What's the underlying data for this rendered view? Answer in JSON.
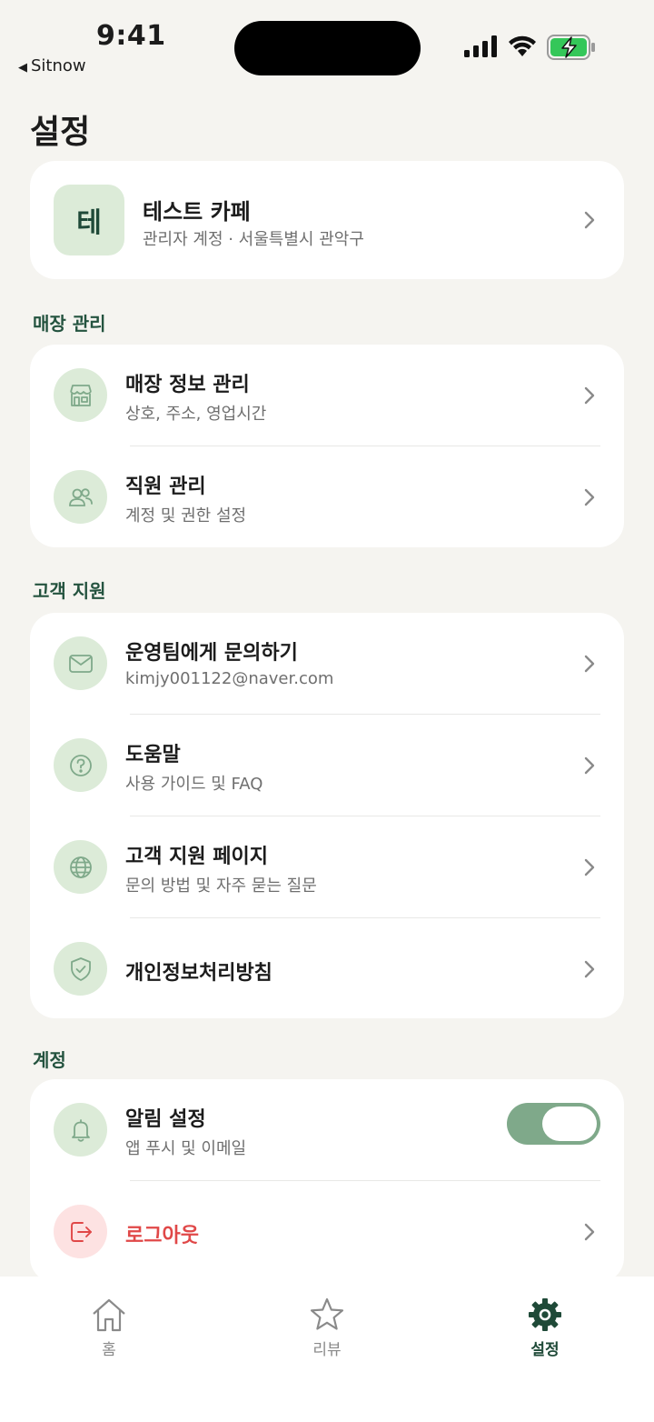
{
  "status_bar": {
    "time": "9:41",
    "back_app": "Sitnow"
  },
  "page": {
    "title": "설정"
  },
  "profile": {
    "avatar_letter": "테",
    "name": "테스트 카페",
    "subtitle": "관리자 계정 · 서울특별시 관악구"
  },
  "sections": {
    "store": {
      "label": "매장 관리",
      "items": [
        {
          "icon": "store-icon",
          "title": "매장 정보 관리",
          "subtitle": "상호, 주소, 영업시간"
        },
        {
          "icon": "users-icon",
          "title": "직원 관리",
          "subtitle": "계정 및 권한 설정"
        }
      ]
    },
    "support": {
      "label": "고객 지원",
      "items": [
        {
          "icon": "mail-icon",
          "title": "운영팀에게 문의하기",
          "subtitle": "kimjy001122@naver.com"
        },
        {
          "icon": "help-icon",
          "title": "도움말",
          "subtitle": "사용 가이드 및 FAQ"
        },
        {
          "icon": "globe-icon",
          "title": "고객 지원 페이지",
          "subtitle": "문의 방법 및 자주 묻는 질문"
        },
        {
          "icon": "shield-check-icon",
          "title": "개인정보처리방침"
        }
      ]
    },
    "account": {
      "label": "계정",
      "items": [
        {
          "icon": "bell-icon",
          "title": "알림 설정",
          "subtitle": "앱 푸시 및 이메일",
          "toggle_on": true
        },
        {
          "icon": "logout-icon",
          "title": "로그아웃"
        }
      ]
    }
  },
  "tabs": [
    {
      "icon": "home-icon",
      "label": "홈",
      "active": false
    },
    {
      "icon": "star-icon",
      "label": "리뷰",
      "active": false
    },
    {
      "icon": "gear-icon",
      "label": "설정",
      "active": true
    }
  ],
  "colors": {
    "accent": "#1f4a38",
    "icon_bg": "#dcebd8",
    "danger": "#e04848",
    "toggle_on": "#7fa98a",
    "background": "#f5f4f0"
  }
}
